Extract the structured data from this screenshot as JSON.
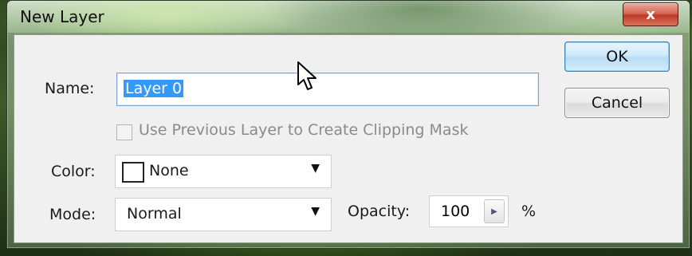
{
  "dialog": {
    "title": "New Layer",
    "close_glyph": "x"
  },
  "form": {
    "name_label": "Name:",
    "name_value": "Layer 0",
    "clip_checkbox_label": "Use Previous Layer to Create Clipping Mask",
    "clip_checked": false,
    "clip_enabled": false,
    "color_label": "Color:",
    "color_value": "None",
    "mode_label": "Mode:",
    "mode_value": "Normal",
    "opacity_label": "Opacity:",
    "opacity_value": "100",
    "opacity_unit": "%"
  },
  "buttons": {
    "ok_label": "OK",
    "cancel_label": "Cancel"
  },
  "icons": {
    "close": "close-icon",
    "dropdown": "chevron-down-icon",
    "stepper": "chevron-right-icon",
    "cursor": "mouse-pointer-icon"
  },
  "colors": {
    "selection": "#3399ff",
    "ok_border": "#3c7fb1",
    "close_red": "#c0392b"
  }
}
